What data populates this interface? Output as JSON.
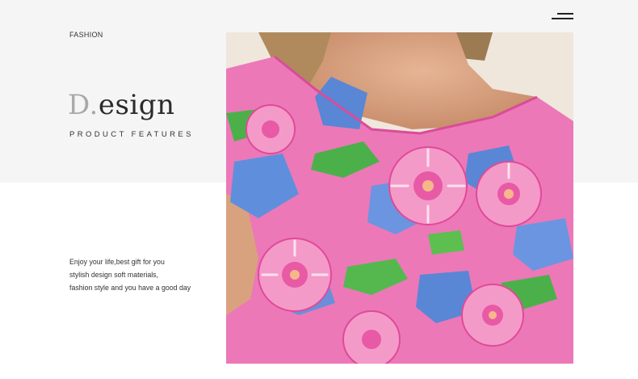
{
  "header": {
    "menu_icon": "hamburger-menu-icon"
  },
  "intro": {
    "kicker": "FASHION",
    "title_initial": "D.",
    "title_rest": "esign",
    "subtitle": "PRODUCT FEATURES"
  },
  "body": {
    "lines": [
      "Enjoy your life,best gift for you",
      "stylish design soft materials,",
      "fashion style and you have a good day"
    ]
  },
  "colors": {
    "top_band": "#f5f5f6",
    "text": "#333333",
    "title_initial": "#a9a9a9",
    "print_pink": "#ec6fb6",
    "print_blue": "#5a86d6",
    "print_green": "#4cb04a"
  }
}
